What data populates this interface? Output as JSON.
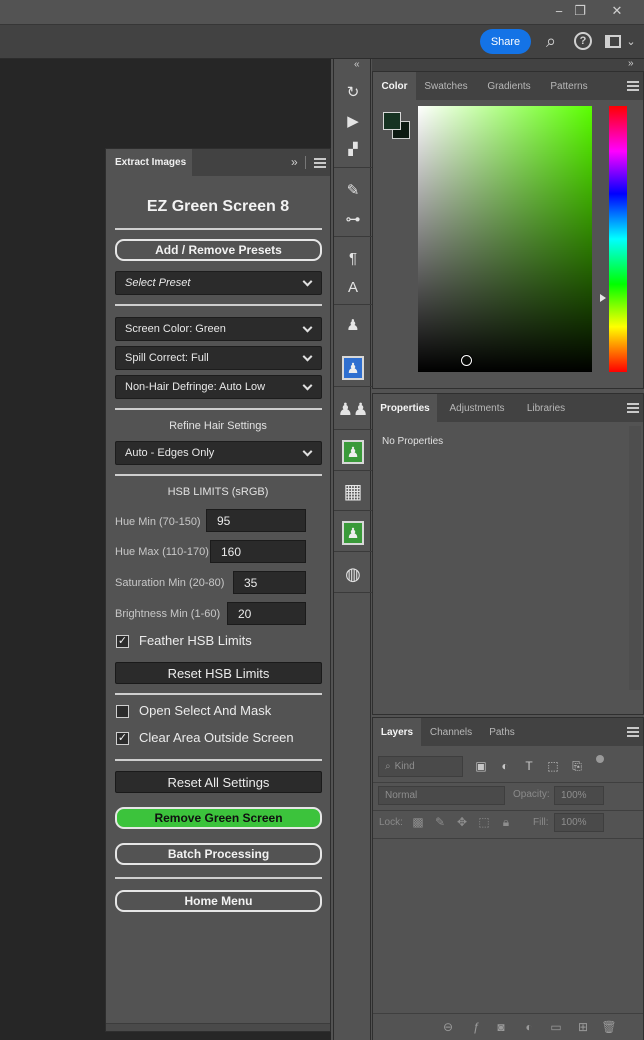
{
  "window": {
    "minimize": "−",
    "restore": "❐",
    "close": "✕"
  },
  "topbar": {
    "share_label": "Share",
    "search_icon": "⌕",
    "help_icon": "?",
    "workspace_icon": "▭",
    "chevron_icon": "⌄"
  },
  "extension": {
    "tab_label": "Extract Images",
    "title": "EZ Green Screen 8",
    "add_remove_presets": "Add / Remove Presets",
    "select_preset": "Select Preset",
    "screen_color": "Screen Color: Green",
    "spill_correct": "Spill Correct: Full",
    "non_hair_defringe": "Non-Hair Defringe: Auto Low",
    "refine_hair_label": "Refine Hair Settings",
    "refine_hair_value": "Auto - Edges Only",
    "hsb_label": "HSB LIMITS (sRGB)",
    "hue_min_label": "Hue Min (70-150)",
    "hue_min_value": "95",
    "hue_max_label": "Hue Max (110-170)",
    "hue_max_value": "160",
    "sat_min_label": "Saturation Min (20-80)",
    "sat_min_value": "35",
    "bri_min_label": "Brightness Min (1-60)",
    "bri_min_value": "20",
    "feather_label": "Feather HSB Limits",
    "feather_checked": true,
    "reset_hsb": "Reset HSB Limits",
    "open_select_label": "Open Select And Mask",
    "open_select_checked": false,
    "clear_area_label": "Clear Area Outside Screen",
    "clear_area_checked": true,
    "reset_all": "Reset All Settings",
    "remove_green": "Remove Green Screen",
    "batch": "Batch Processing",
    "home": "Home Menu",
    "check_mark": "✓"
  },
  "color_panel": {
    "tabs": [
      "Color",
      "Swatches",
      "Gradients",
      "Patterns"
    ],
    "foreground": "#163322",
    "background": "#0d1a12"
  },
  "properties_panel": {
    "tabs": [
      "Properties",
      "Adjustments",
      "Libraries"
    ],
    "empty_text": "No Properties"
  },
  "layers_panel": {
    "tabs": [
      "Layers",
      "Channels",
      "Paths"
    ],
    "kind_placeholder": "Kind",
    "blend_mode": "Normal",
    "opacity_label": "Opacity:",
    "opacity_value": "100%",
    "lock_label": "Lock:",
    "fill_label": "Fill:",
    "fill_value": "100%"
  },
  "colors": {
    "accent_blue": "#1473e6",
    "remove_green": "#3cc33c"
  }
}
